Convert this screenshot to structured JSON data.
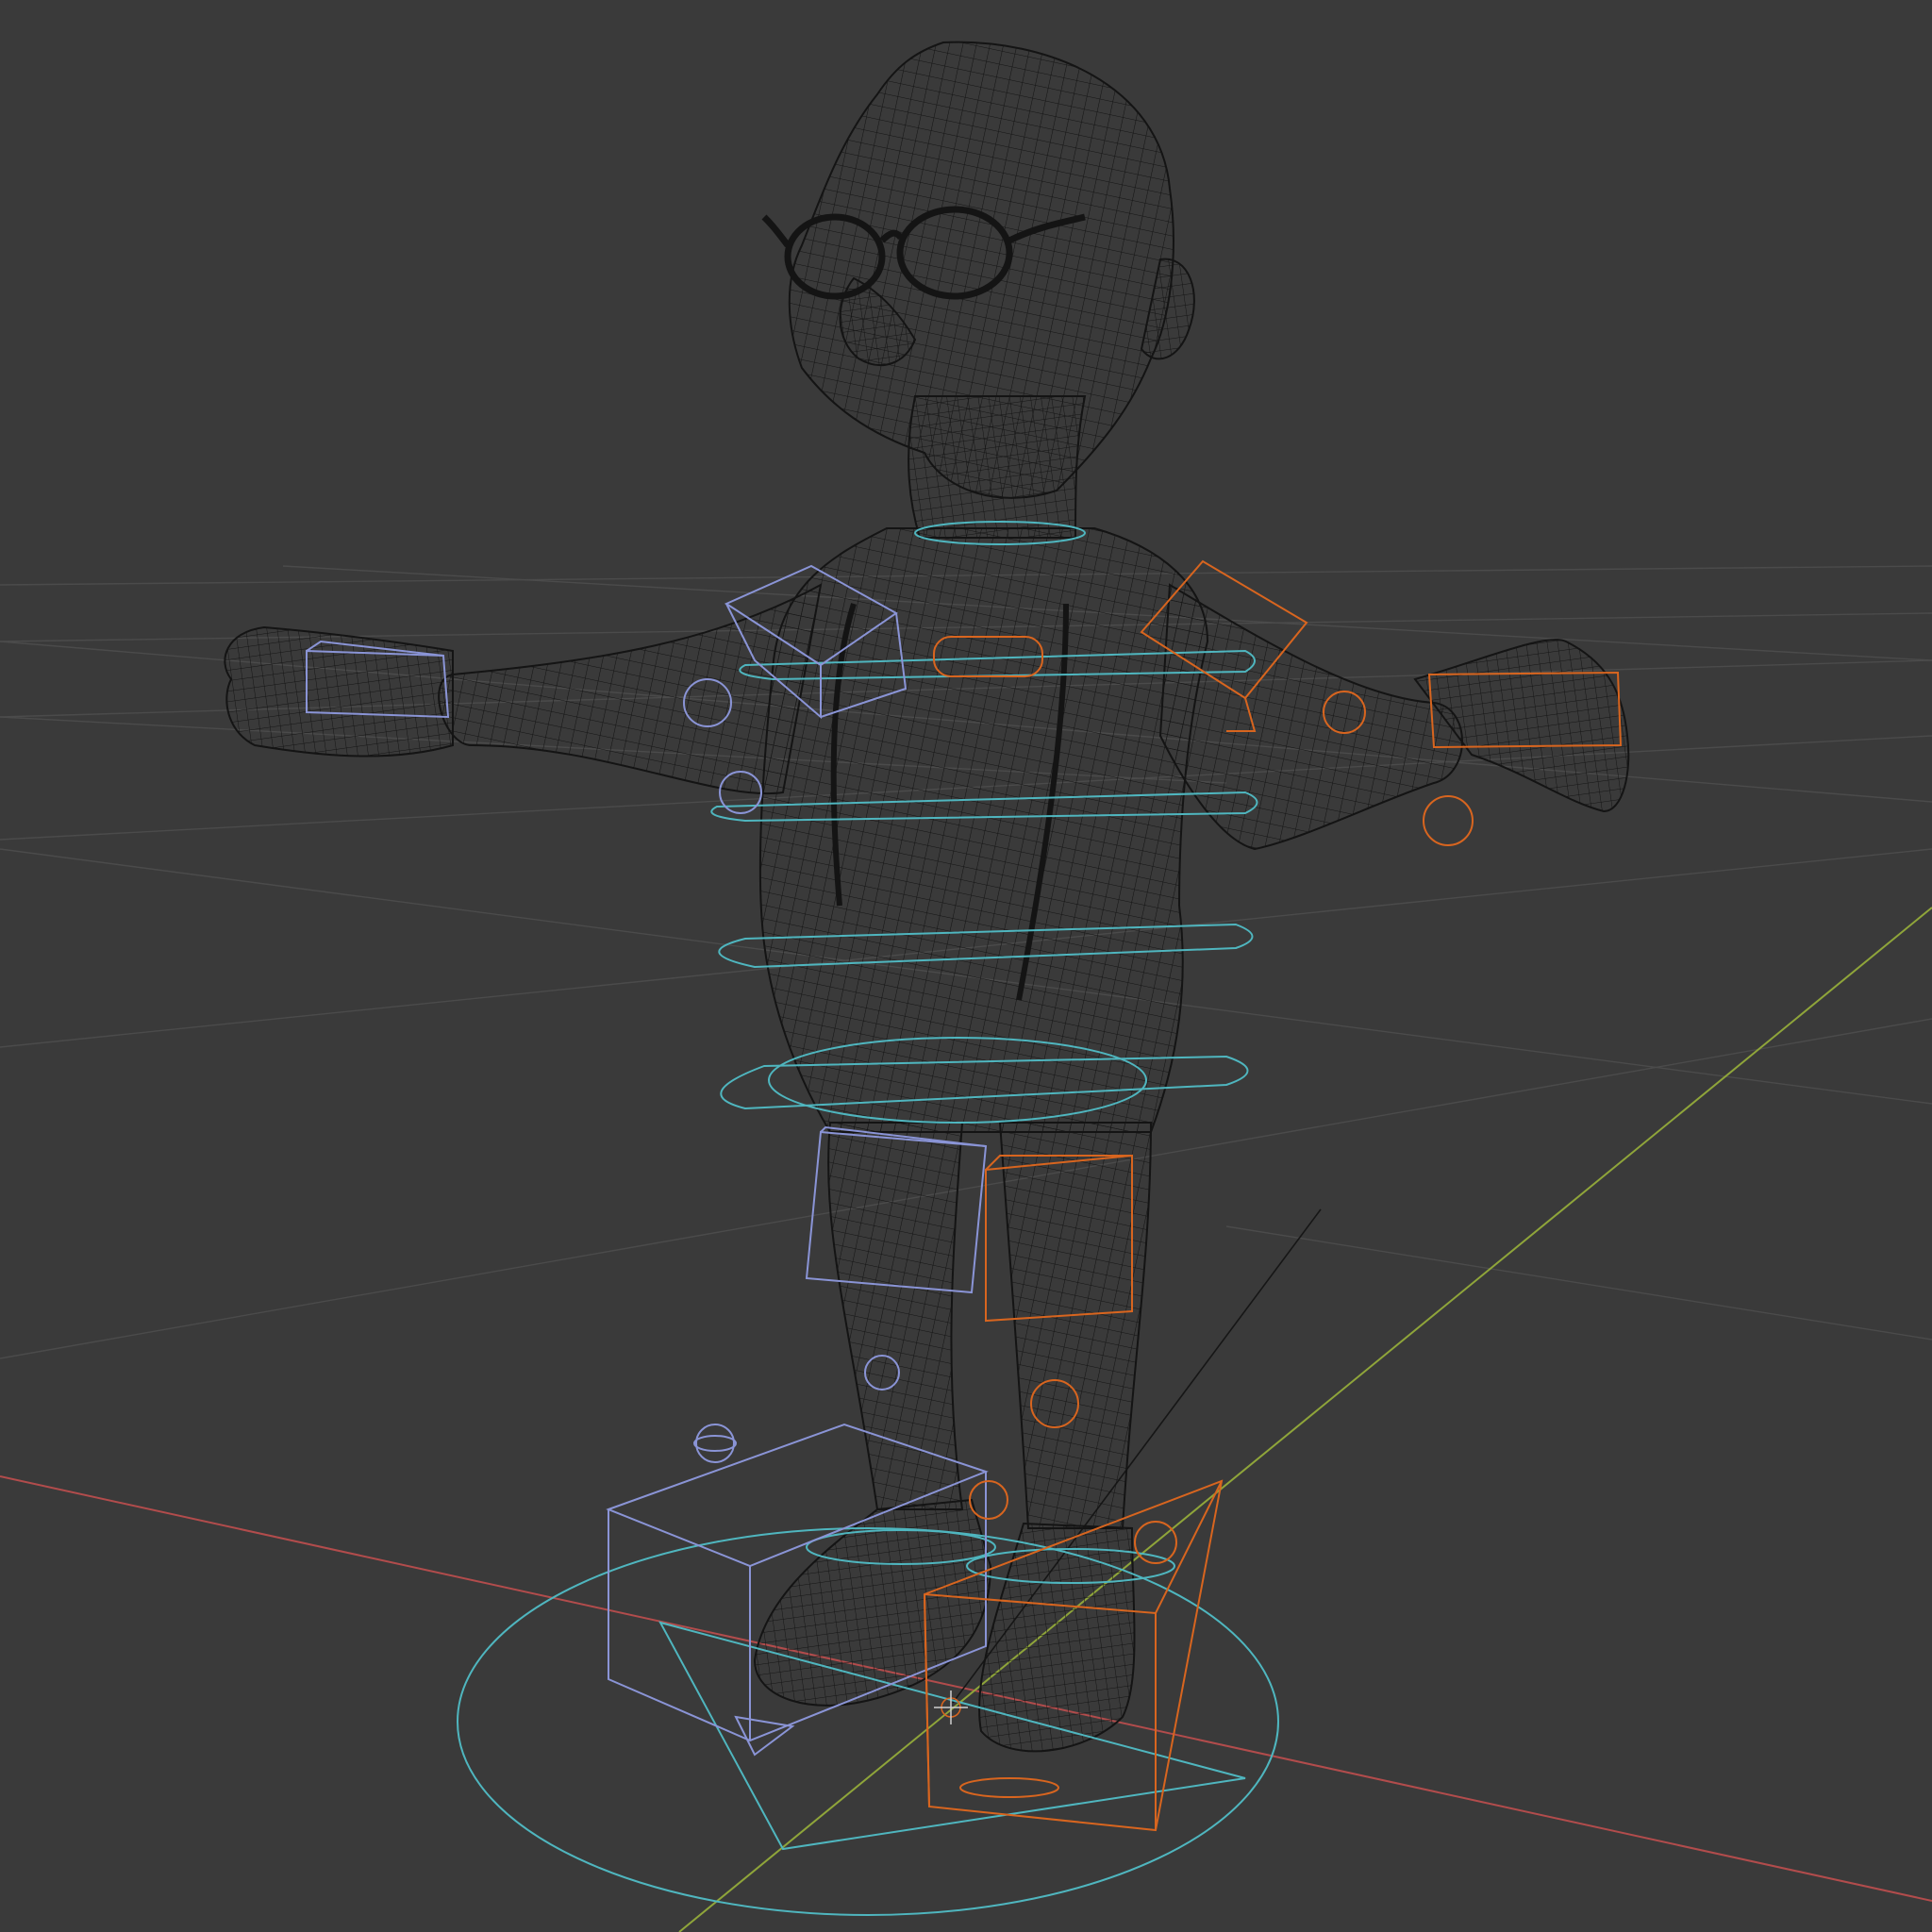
{
  "viewport": {
    "mode": "wireframe",
    "background": "#3a3a3a",
    "grid_color": "#4a4a4a",
    "axis_x_color": "#b24c4c",
    "axis_y_color": "#8fa53a",
    "mesh_color": "#141414",
    "left_control_color": "#8a94d6",
    "right_control_color": "#d8651f",
    "center_control_color": "#4fb6bf",
    "scene_object": "wireframe-character-with-glasses",
    "rig": "character-control-rig"
  }
}
